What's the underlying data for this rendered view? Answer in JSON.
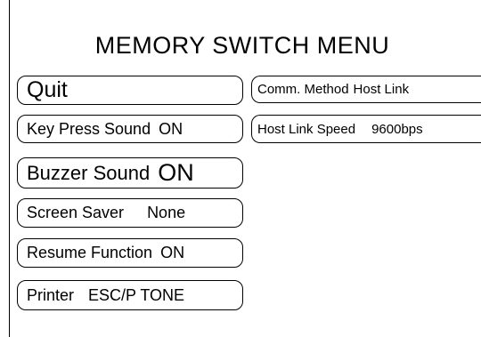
{
  "menu": {
    "title": "MEMORY SWITCH MENU",
    "left_buttons": [
      {
        "label": "Quit"
      },
      {
        "label": "Key Press Sound",
        "value": "ON"
      },
      {
        "label": "Buzzer Sound",
        "value": "ON"
      },
      {
        "label": "Screen Saver",
        "value": "None"
      },
      {
        "label": "Resume Function",
        "value": "ON"
      },
      {
        "label": "Printer",
        "value": "ESC/P TONE"
      }
    ],
    "right_buttons": [
      {
        "label": "Comm. Method",
        "value": "Host Link"
      },
      {
        "label": "Host Link Speed",
        "value": "9600bps"
      }
    ]
  }
}
